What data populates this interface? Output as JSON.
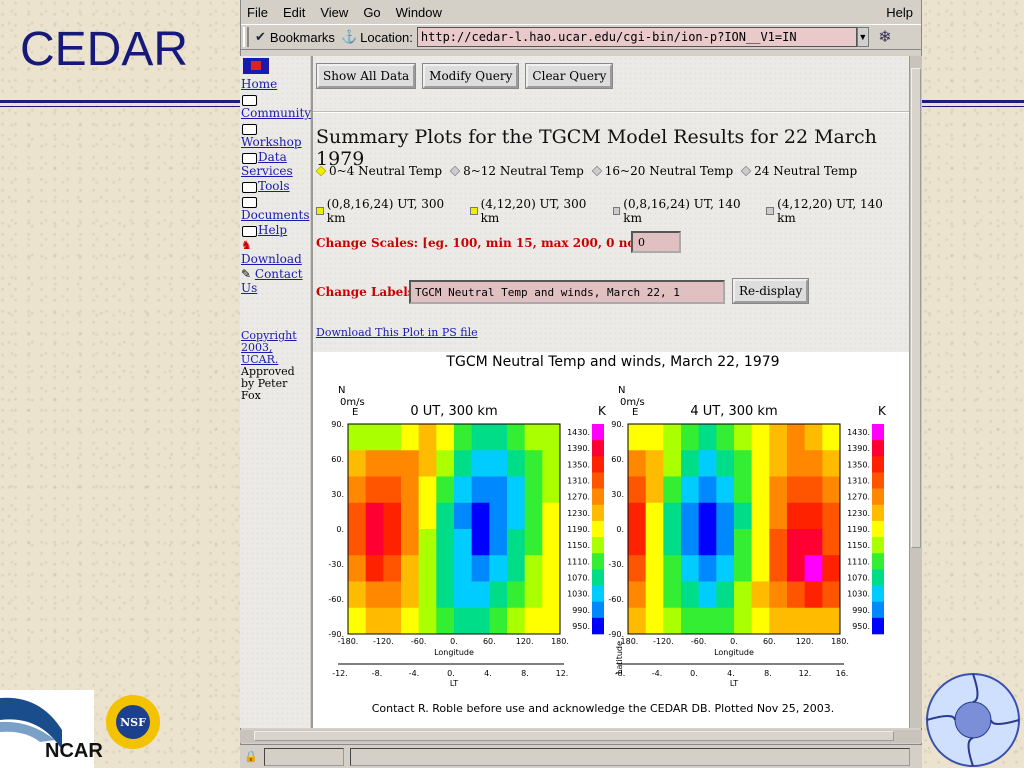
{
  "slide": {
    "title": "CEDAR",
    "ncar_label": "NCAR"
  },
  "browser": {
    "menu": [
      "File",
      "Edit",
      "View",
      "Go",
      "Window"
    ],
    "help": "Help",
    "bookmarks_label": "Bookmarks",
    "location_label": "Location:",
    "url": "http://cedar-l.hao.ucar.edu/cgi-bin/ion-p?ION__V1=IN"
  },
  "nav": {
    "items": [
      "Home",
      "Community",
      "Workshop",
      "Data Services",
      "Tools",
      "Documents",
      "Help",
      "Download",
      "Contact Us"
    ],
    "copyright_link": "Copyright 2003, UCAR.",
    "approved": "Approved by Peter Fox"
  },
  "main": {
    "buttons": [
      "Show All Data",
      "Modify Query",
      "Clear Query"
    ],
    "heading": "Summary Plots for the TGCM Model Results for 22 March 1979",
    "radio_options": [
      "0~4 Neutral Temp",
      "8~12 Neutral Temp",
      "16~20 Neutral Temp",
      "24 Neutral Temp"
    ],
    "radio_selected": 0,
    "checkbox_options": [
      "(0,8,16,24) UT, 300 km",
      "(4,12,20) UT, 300 km",
      "(0,8,16,24) UT, 140 km",
      "(4,12,20) UT, 140 km"
    ],
    "checkbox_checked": [
      true,
      true,
      false,
      false
    ],
    "scales_label": "Change Scales: [eg. 100, min 15, max 200, 0 no scale]",
    "scales_value": "0",
    "labels_label": "Change Labels:",
    "labels_value": "TGCM Neutral Temp and winds, March 22, 1",
    "redisplay": "Re-display",
    "download_link": "Download This Plot in PS file"
  },
  "chart_data": [
    {
      "type": "heatmap",
      "title": "TGCM Neutral Temp and winds, March 22, 1979",
      "subtitle": "0 UT, 300 km",
      "xlabel": "Longitude",
      "ylabel": "Latitude",
      "corner_labels": [
        "N",
        "0m/s",
        "E",
        "K"
      ],
      "x_ticks": [
        "-180.",
        "-120.",
        "-60.",
        "0.",
        "60.",
        "120.",
        "180."
      ],
      "y_ticks": [
        "90.",
        "60.",
        "30.",
        "0.",
        "-30.",
        "-60.",
        "-90."
      ],
      "lt_ticks": [
        "-12.",
        "-8.",
        "-4.",
        "0.",
        "4.",
        "8.",
        "12."
      ],
      "lt_label": "LT",
      "colorbar": [
        "1430.",
        "1390.",
        "1350.",
        "1310.",
        "1270.",
        "1230.",
        "1190.",
        "1150.",
        "1110.",
        "1070.",
        "1030.",
        "990.",
        "950."
      ],
      "colorbar_colors": [
        "#ff00ff",
        "#ff0033",
        "#ff2200",
        "#ff5500",
        "#ff8800",
        "#ffbb00",
        "#ffff00",
        "#aaff00",
        "#33ee33",
        "#00dd88",
        "#00ccff",
        "#0088ff",
        "#0000ff"
      ],
      "field": [
        [
          1150,
          1150,
          1150,
          1190,
          1230,
          1190,
          1110,
          1070,
          1070,
          1110,
          1150,
          1150
        ],
        [
          1230,
          1270,
          1270,
          1270,
          1230,
          1150,
          1070,
          1030,
          1030,
          1070,
          1110,
          1150
        ],
        [
          1270,
          1310,
          1310,
          1270,
          1190,
          1110,
          1030,
          990,
          990,
          1030,
          1110,
          1150
        ],
        [
          1310,
          1390,
          1350,
          1270,
          1190,
          1070,
          990,
          950,
          990,
          1030,
          1110,
          1190
        ],
        [
          1310,
          1390,
          1350,
          1270,
          1150,
          1070,
          1030,
          950,
          990,
          1070,
          1110,
          1190
        ],
        [
          1270,
          1350,
          1310,
          1230,
          1150,
          1070,
          1030,
          990,
          1030,
          1070,
          1150,
          1190
        ],
        [
          1230,
          1270,
          1270,
          1230,
          1150,
          1070,
          1030,
          1030,
          1070,
          1110,
          1150,
          1190
        ],
        [
          1190,
          1230,
          1230,
          1190,
          1150,
          1110,
          1070,
          1070,
          1110,
          1150,
          1190,
          1190
        ]
      ]
    },
    {
      "type": "heatmap",
      "title": "",
      "subtitle": "4 UT, 300 km",
      "xlabel": "Longitude",
      "ylabel": "Latitude",
      "corner_labels": [
        "N",
        "0m/s",
        "E",
        "K"
      ],
      "x_ticks": [
        "-180.",
        "-120.",
        "-60.",
        "0.",
        "60.",
        "120.",
        "180."
      ],
      "y_ticks": [
        "90.",
        "60.",
        "30.",
        "0.",
        "-30.",
        "-60.",
        "-90."
      ],
      "lt_ticks": [
        "-8.",
        "-4.",
        "0.",
        "4.",
        "8.",
        "12.",
        "16."
      ],
      "lt_label": "LT",
      "colorbar": [
        "1430.",
        "1390.",
        "1350.",
        "1310.",
        "1270.",
        "1230.",
        "1190.",
        "1150.",
        "1110.",
        "1070.",
        "1030.",
        "990.",
        "950."
      ],
      "colorbar_colors": [
        "#ff00ff",
        "#ff0033",
        "#ff2200",
        "#ff5500",
        "#ff8800",
        "#ffbb00",
        "#ffff00",
        "#aaff00",
        "#33ee33",
        "#00dd88",
        "#00ccff",
        "#0088ff",
        "#0000ff"
      ],
      "field": [
        [
          1190,
          1190,
          1150,
          1110,
          1070,
          1110,
          1150,
          1190,
          1230,
          1270,
          1230,
          1190
        ],
        [
          1270,
          1230,
          1150,
          1070,
          1030,
          1070,
          1110,
          1190,
          1230,
          1270,
          1270,
          1230
        ],
        [
          1310,
          1230,
          1110,
          1030,
          990,
          1030,
          1110,
          1190,
          1270,
          1310,
          1310,
          1270
        ],
        [
          1350,
          1190,
          1070,
          990,
          950,
          990,
          1070,
          1190,
          1270,
          1350,
          1350,
          1310
        ],
        [
          1350,
          1190,
          1070,
          990,
          950,
          990,
          1110,
          1190,
          1310,
          1390,
          1390,
          1310
        ],
        [
          1310,
          1190,
          1110,
          1030,
          990,
          1030,
          1110,
          1190,
          1310,
          1390,
          1430,
          1350
        ],
        [
          1270,
          1190,
          1110,
          1070,
          1030,
          1070,
          1150,
          1230,
          1270,
          1310,
          1350,
          1310
        ],
        [
          1230,
          1190,
          1150,
          1110,
          1110,
          1110,
          1150,
          1190,
          1230,
          1230,
          1230,
          1230
        ]
      ]
    }
  ],
  "plot_footer": "Contact R. Roble before use and acknowledge the CEDAR DB.  Plotted Nov 25, 2003."
}
